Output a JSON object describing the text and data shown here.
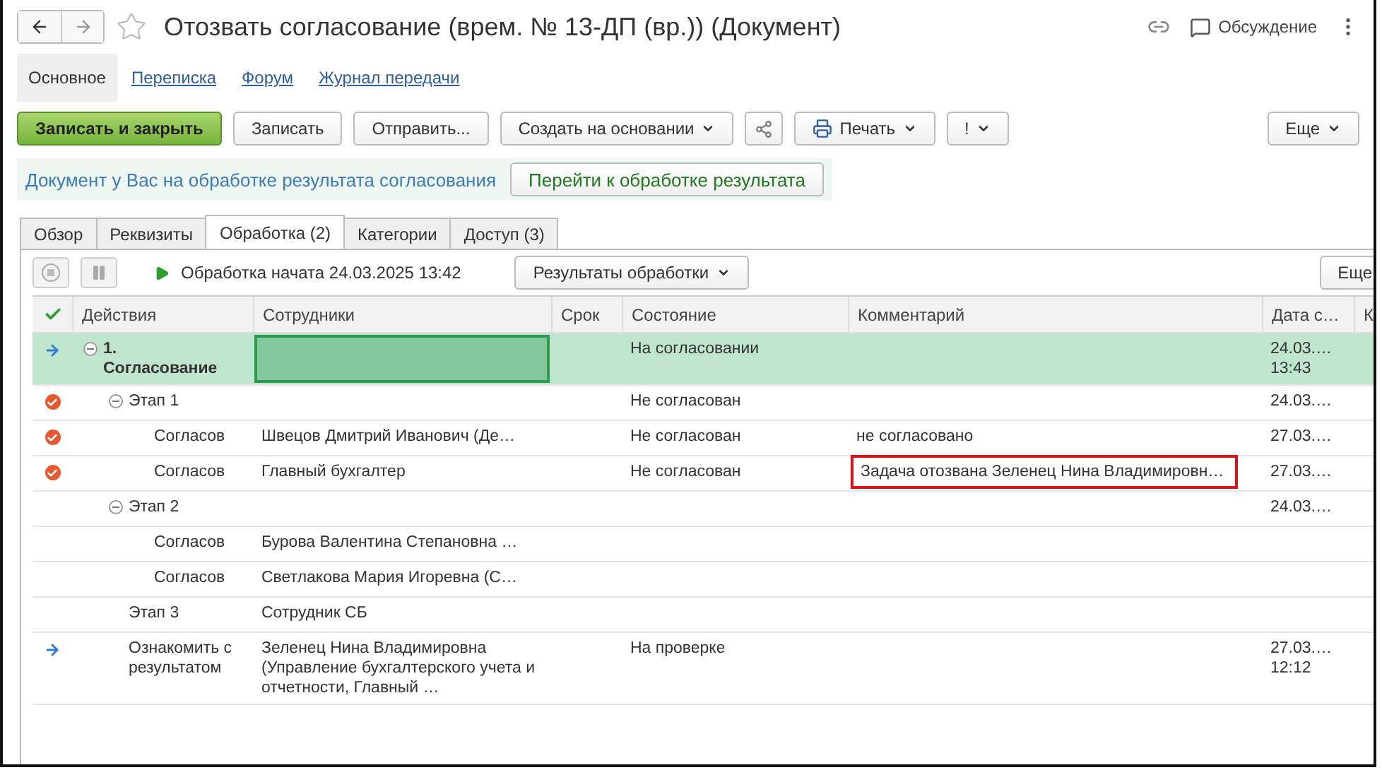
{
  "window": {
    "title": "Отозвать согласование (врем. № 13-ДП (вр.)) (Документ)",
    "discussion": "Обсуждение"
  },
  "sections": [
    {
      "label": "Основное",
      "selected": true
    },
    {
      "label": "Переписка",
      "selected": false
    },
    {
      "label": "Форум",
      "selected": false
    },
    {
      "label": "Журнал передачи",
      "selected": false
    }
  ],
  "toolbar": [
    {
      "kind": "primary",
      "label": "Записать и закрыть",
      "dropdown": false
    },
    {
      "kind": "plain",
      "label": "Записать",
      "dropdown": false
    },
    {
      "kind": "plain",
      "label": "Отправить...",
      "dropdown": false
    },
    {
      "kind": "plain",
      "label": "Создать на основании",
      "dropdown": true
    },
    {
      "kind": "share"
    },
    {
      "kind": "print",
      "label": "Печать",
      "dropdown": true
    },
    {
      "kind": "plain",
      "label": "!",
      "dropdown": true
    }
  ],
  "more_button": "Еще",
  "notice": {
    "text": "Документ у Вас на обработке результата согласования",
    "button": "Перейти к обработке результата"
  },
  "tabs": [
    {
      "label": "Обзор",
      "selected": false
    },
    {
      "label": "Реквизиты",
      "selected": false
    },
    {
      "label": "Обработка (2)",
      "selected": true
    },
    {
      "label": "Категории",
      "selected": false
    },
    {
      "label": "Доступ (3)",
      "selected": false
    }
  ],
  "process": {
    "status": "Обработка начата 24.03.2025 13:42",
    "results_button": "Результаты обработки",
    "more_button": "Еще"
  },
  "table": {
    "columns": [
      "Действия",
      "Сотрудники",
      "Срок",
      "Состояние",
      "Комментарий",
      "Дата с…",
      "К"
    ],
    "rows": [
      {
        "kind": "arrow",
        "action": "1. Согласование",
        "expanded": true,
        "state": "На согласовании",
        "date": "24.03.…",
        "time": "13:43",
        "selected": true,
        "children": [
          {
            "kind": "declined",
            "action": "Этап 1",
            "expanded": true,
            "state": "Не согласован",
            "date": "24.03.…",
            "selected": false,
            "children": [
              {
                "kind": "declined",
                "action": "Согласов",
                "employee": "Швецов Дмитрий Иванович (Де…",
                "state": "Не согласован",
                "comment": "не согласовано",
                "highlighted": false,
                "date": "27.03.…",
                "selected": false
              },
              {
                "kind": "declined",
                "action": "Согласов",
                "employee": "Главный бухгалтер",
                "state": "Не согласован",
                "comment": "Задача отозвана Зеленец Нина Владимировн…",
                "highlighted": true,
                "date": "27.03.…",
                "selected": false
              }
            ]
          },
          {
            "action": "Этап 2",
            "expanded": true,
            "date": "24.03.…",
            "selected": false,
            "children": [
              {
                "action": "Согласов",
                "employee": "Бурова Валентина Степановна …",
                "selected": false
              },
              {
                "action": "Согласов",
                "employee": "Светлакова Мария Игоревна (С…",
                "selected": false
              }
            ]
          },
          {
            "action": "Этап 3",
            "employee": "Сотрудник СБ",
            "selected": false
          },
          {
            "kind": "arrow",
            "action": "Ознакомить с результатом",
            "employee": "Зеленец Нина Владимировна (Управление бухгалтерского учета и отчетности, Главный …",
            "state": "На проверке",
            "date": "27.03.…",
            "time": "12:12",
            "selected": false
          }
        ]
      }
    ]
  }
}
